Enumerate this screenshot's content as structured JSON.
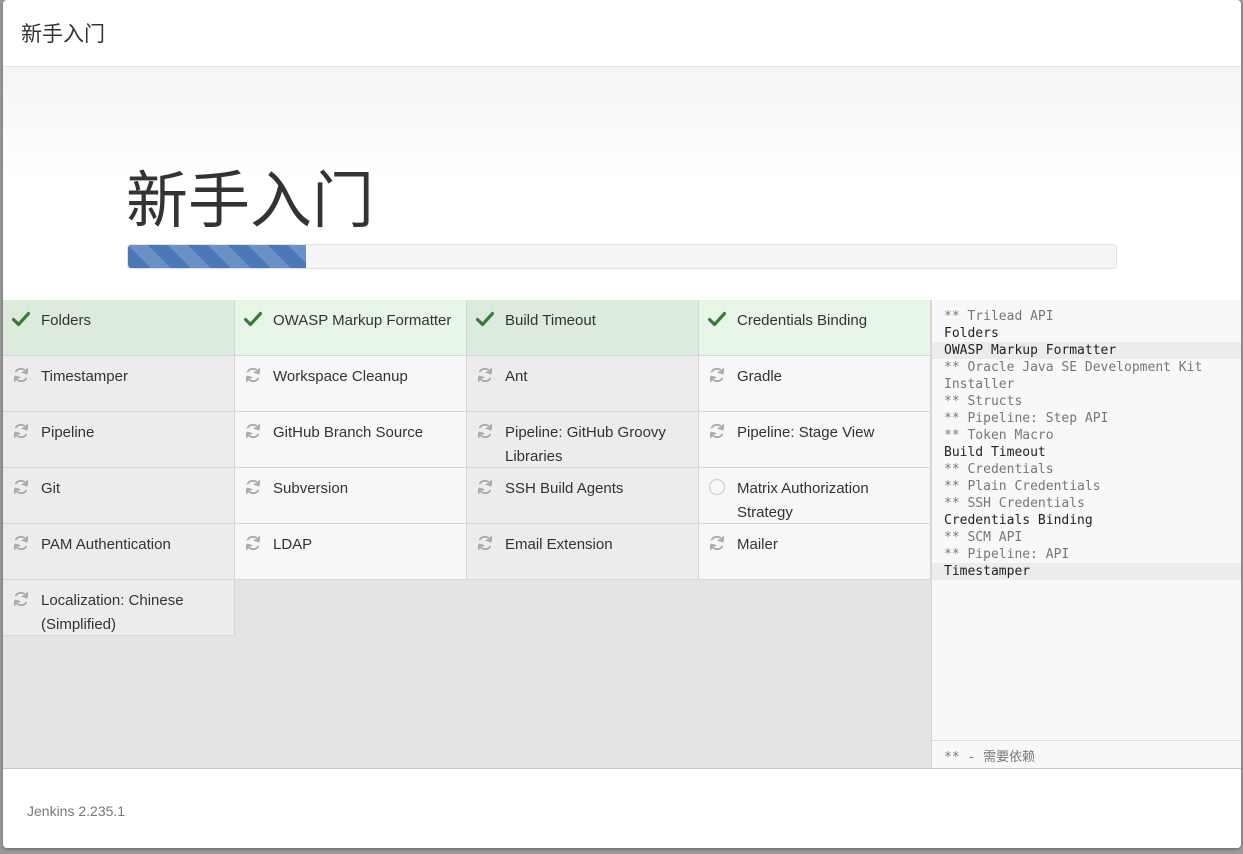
{
  "header": {
    "title": "新手入门"
  },
  "hero": {
    "title": "新手入门",
    "progress": 0.18
  },
  "colors": {
    "success": "#3c7a3c",
    "pending": "#a8a8a8",
    "progress": "#4a78b8"
  },
  "plugins": [
    {
      "name": "Folders",
      "status": "success"
    },
    {
      "name": "OWASP Markup Formatter",
      "status": "success"
    },
    {
      "name": "Build Timeout",
      "status": "success"
    },
    {
      "name": "Credentials Binding",
      "status": "success"
    },
    {
      "name": "Timestamper",
      "status": "installing"
    },
    {
      "name": "Workspace Cleanup",
      "status": "installing"
    },
    {
      "name": "Ant",
      "status": "installing"
    },
    {
      "name": "Gradle",
      "status": "installing"
    },
    {
      "name": "Pipeline",
      "status": "installing"
    },
    {
      "name": "GitHub Branch Source",
      "status": "installing"
    },
    {
      "name": "Pipeline: GitHub Groovy Libraries",
      "status": "installing"
    },
    {
      "name": "Pipeline: Stage View",
      "status": "installing"
    },
    {
      "name": "Git",
      "status": "installing"
    },
    {
      "name": "Subversion",
      "status": "installing"
    },
    {
      "name": "SSH Build Agents",
      "status": "installing"
    },
    {
      "name": "Matrix Authorization Strategy",
      "status": "pending"
    },
    {
      "name": "PAM Authentication",
      "status": "installing"
    },
    {
      "name": "LDAP",
      "status": "installing"
    },
    {
      "name": "Email Extension",
      "status": "installing"
    },
    {
      "name": "Mailer",
      "status": "installing"
    },
    {
      "name": "Localization: Chinese (Simplified)",
      "status": "installing"
    }
  ],
  "log": {
    "lines": [
      {
        "text": "** Trilead API",
        "dep": true,
        "hl": false
      },
      {
        "text": "Folders",
        "dep": false,
        "hl": false
      },
      {
        "text": "OWASP Markup Formatter",
        "dep": false,
        "hl": true
      },
      {
        "text": "** Oracle Java SE Development Kit",
        "dep": true,
        "hl": false
      },
      {
        "text": "Installer",
        "dep": true,
        "hl": false
      },
      {
        "text": "** Structs",
        "dep": true,
        "hl": false
      },
      {
        "text": "** Pipeline: Step API",
        "dep": true,
        "hl": false
      },
      {
        "text": "** Token Macro",
        "dep": true,
        "hl": false
      },
      {
        "text": "Build Timeout",
        "dep": false,
        "hl": false
      },
      {
        "text": "** Credentials",
        "dep": true,
        "hl": false
      },
      {
        "text": "** Plain Credentials",
        "dep": true,
        "hl": false
      },
      {
        "text": "** SSH Credentials",
        "dep": true,
        "hl": false
      },
      {
        "text": "Credentials Binding",
        "dep": false,
        "hl": false
      },
      {
        "text": "** SCM API",
        "dep": true,
        "hl": false
      },
      {
        "text": "** Pipeline: API",
        "dep": true,
        "hl": false
      },
      {
        "text": "Timestamper",
        "dep": false,
        "hl": true
      }
    ],
    "legend": "** - 需要依赖"
  },
  "footer": {
    "version": "Jenkins 2.235.1"
  }
}
